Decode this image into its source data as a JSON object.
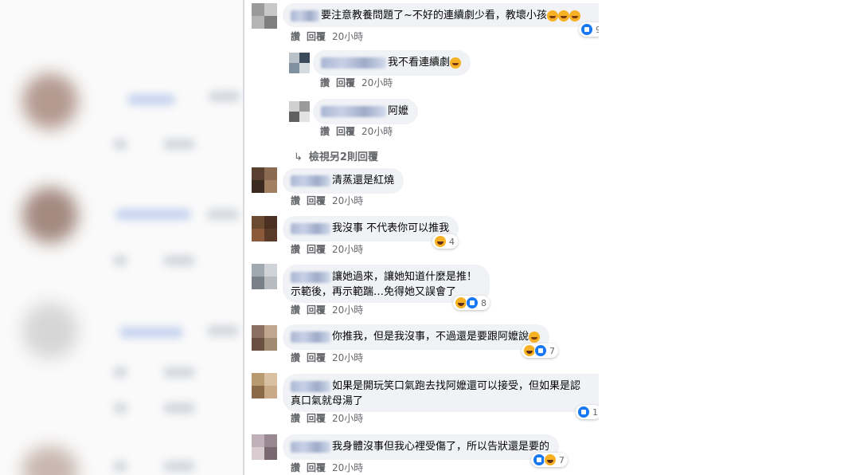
{
  "comments": [
    {
      "text": "要注意教養問題了~不好的連續劇少看，教壞小孩",
      "actions": {
        "like": "讚",
        "reply": "回覆",
        "time": "20小時"
      },
      "reaction_count": "9"
    },
    {
      "text": "我不看連續劇",
      "actions": {
        "like": "讚",
        "reply": "回覆",
        "time": "20小時"
      }
    },
    {
      "text": "阿嬤",
      "actions": {
        "like": "讚",
        "reply": "回覆",
        "time": "20小時"
      }
    },
    {
      "text": "清蒸還是紅燒",
      "actions": {
        "like": "讚",
        "reply": "回覆",
        "time": "20小時"
      }
    },
    {
      "text": "我沒事 不代表你可以推我",
      "actions": {
        "like": "讚",
        "reply": "回覆",
        "time": "20小時"
      },
      "reaction_count": "4"
    },
    {
      "text_line1": "讓她過來，讓她知道什麼是推！",
      "text_line2": "示範後，再示範踹…免得她又誤會了",
      "actions": {
        "like": "讚",
        "reply": "回覆",
        "time": "20小時"
      },
      "reaction_count": "8"
    },
    {
      "text": "你推我，但是我沒事，不過還是要跟阿嬤說",
      "actions": {
        "like": "讚",
        "reply": "回覆",
        "time": "20小時"
      },
      "reaction_count": "7"
    },
    {
      "text_line1": "如果是開玩笑口氣跑去找阿嬤還可以接受，但如果是認",
      "text_line2": "真口氣就母湯了",
      "actions": {
        "like": "讚",
        "reply": "回覆",
        "time": "20小時"
      },
      "reaction_count": "1"
    },
    {
      "text": "我身體沒事但我心裡受傷了，所以告狀還是要的",
      "actions": {
        "like": "讚",
        "reply": "回覆",
        "time": "20小時"
      },
      "reaction_count": "7"
    }
  ],
  "view_more_replies": "檢視另2則回覆",
  "colors": {
    "bubble": "#f0f2f5",
    "meta": "#65676b",
    "text": "#050505",
    "like": "#1877f2",
    "haha": "#f7b125"
  }
}
